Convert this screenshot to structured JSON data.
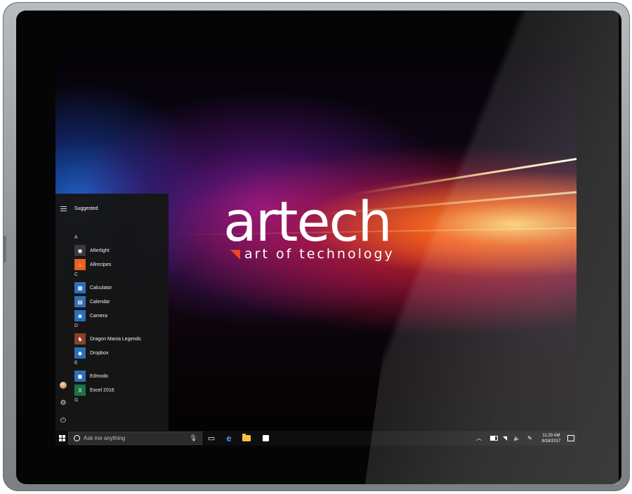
{
  "wallpaper": {
    "logo_word": "artech",
    "logo_tagline": "art of technology",
    "accent_color": "#f2451e"
  },
  "start_menu": {
    "suggested_label": "Suggested",
    "groups": [
      {
        "letter": "A",
        "apps": [
          {
            "name": "Afterlight",
            "icon": "afterlight-icon",
            "color": "#3a3a3a"
          },
          {
            "name": "Allrecipes",
            "icon": "allrecipes-icon",
            "color": "#e8601c"
          }
        ]
      },
      {
        "letter": "C",
        "apps": [
          {
            "name": "Calculator",
            "icon": "calculator-icon",
            "color": "#2d6fb8"
          },
          {
            "name": "Calendar",
            "icon": "calendar-icon",
            "color": "#2d6fb8"
          },
          {
            "name": "Camera",
            "icon": "camera-icon",
            "color": "#2d6fb8"
          }
        ]
      },
      {
        "letter": "D",
        "apps": [
          {
            "name": "Dragon Mania Legends",
            "icon": "dragon-mania-icon",
            "color": "#8c3f2a"
          },
          {
            "name": "Dropbox",
            "icon": "dropbox-icon",
            "color": "#2d6fb8"
          }
        ]
      },
      {
        "letter": "E",
        "apps": [
          {
            "name": "Edmodo",
            "icon": "edmodo-icon",
            "color": "#2d6fb8"
          },
          {
            "name": "Excel 2016",
            "icon": "excel-icon",
            "color": "#1e7145"
          }
        ]
      },
      {
        "letter": "G",
        "apps": []
      }
    ]
  },
  "taskbar": {
    "search_placeholder": "Ask me anything",
    "clock_time": "11:20 AM",
    "clock_date": "8/18/2017"
  }
}
